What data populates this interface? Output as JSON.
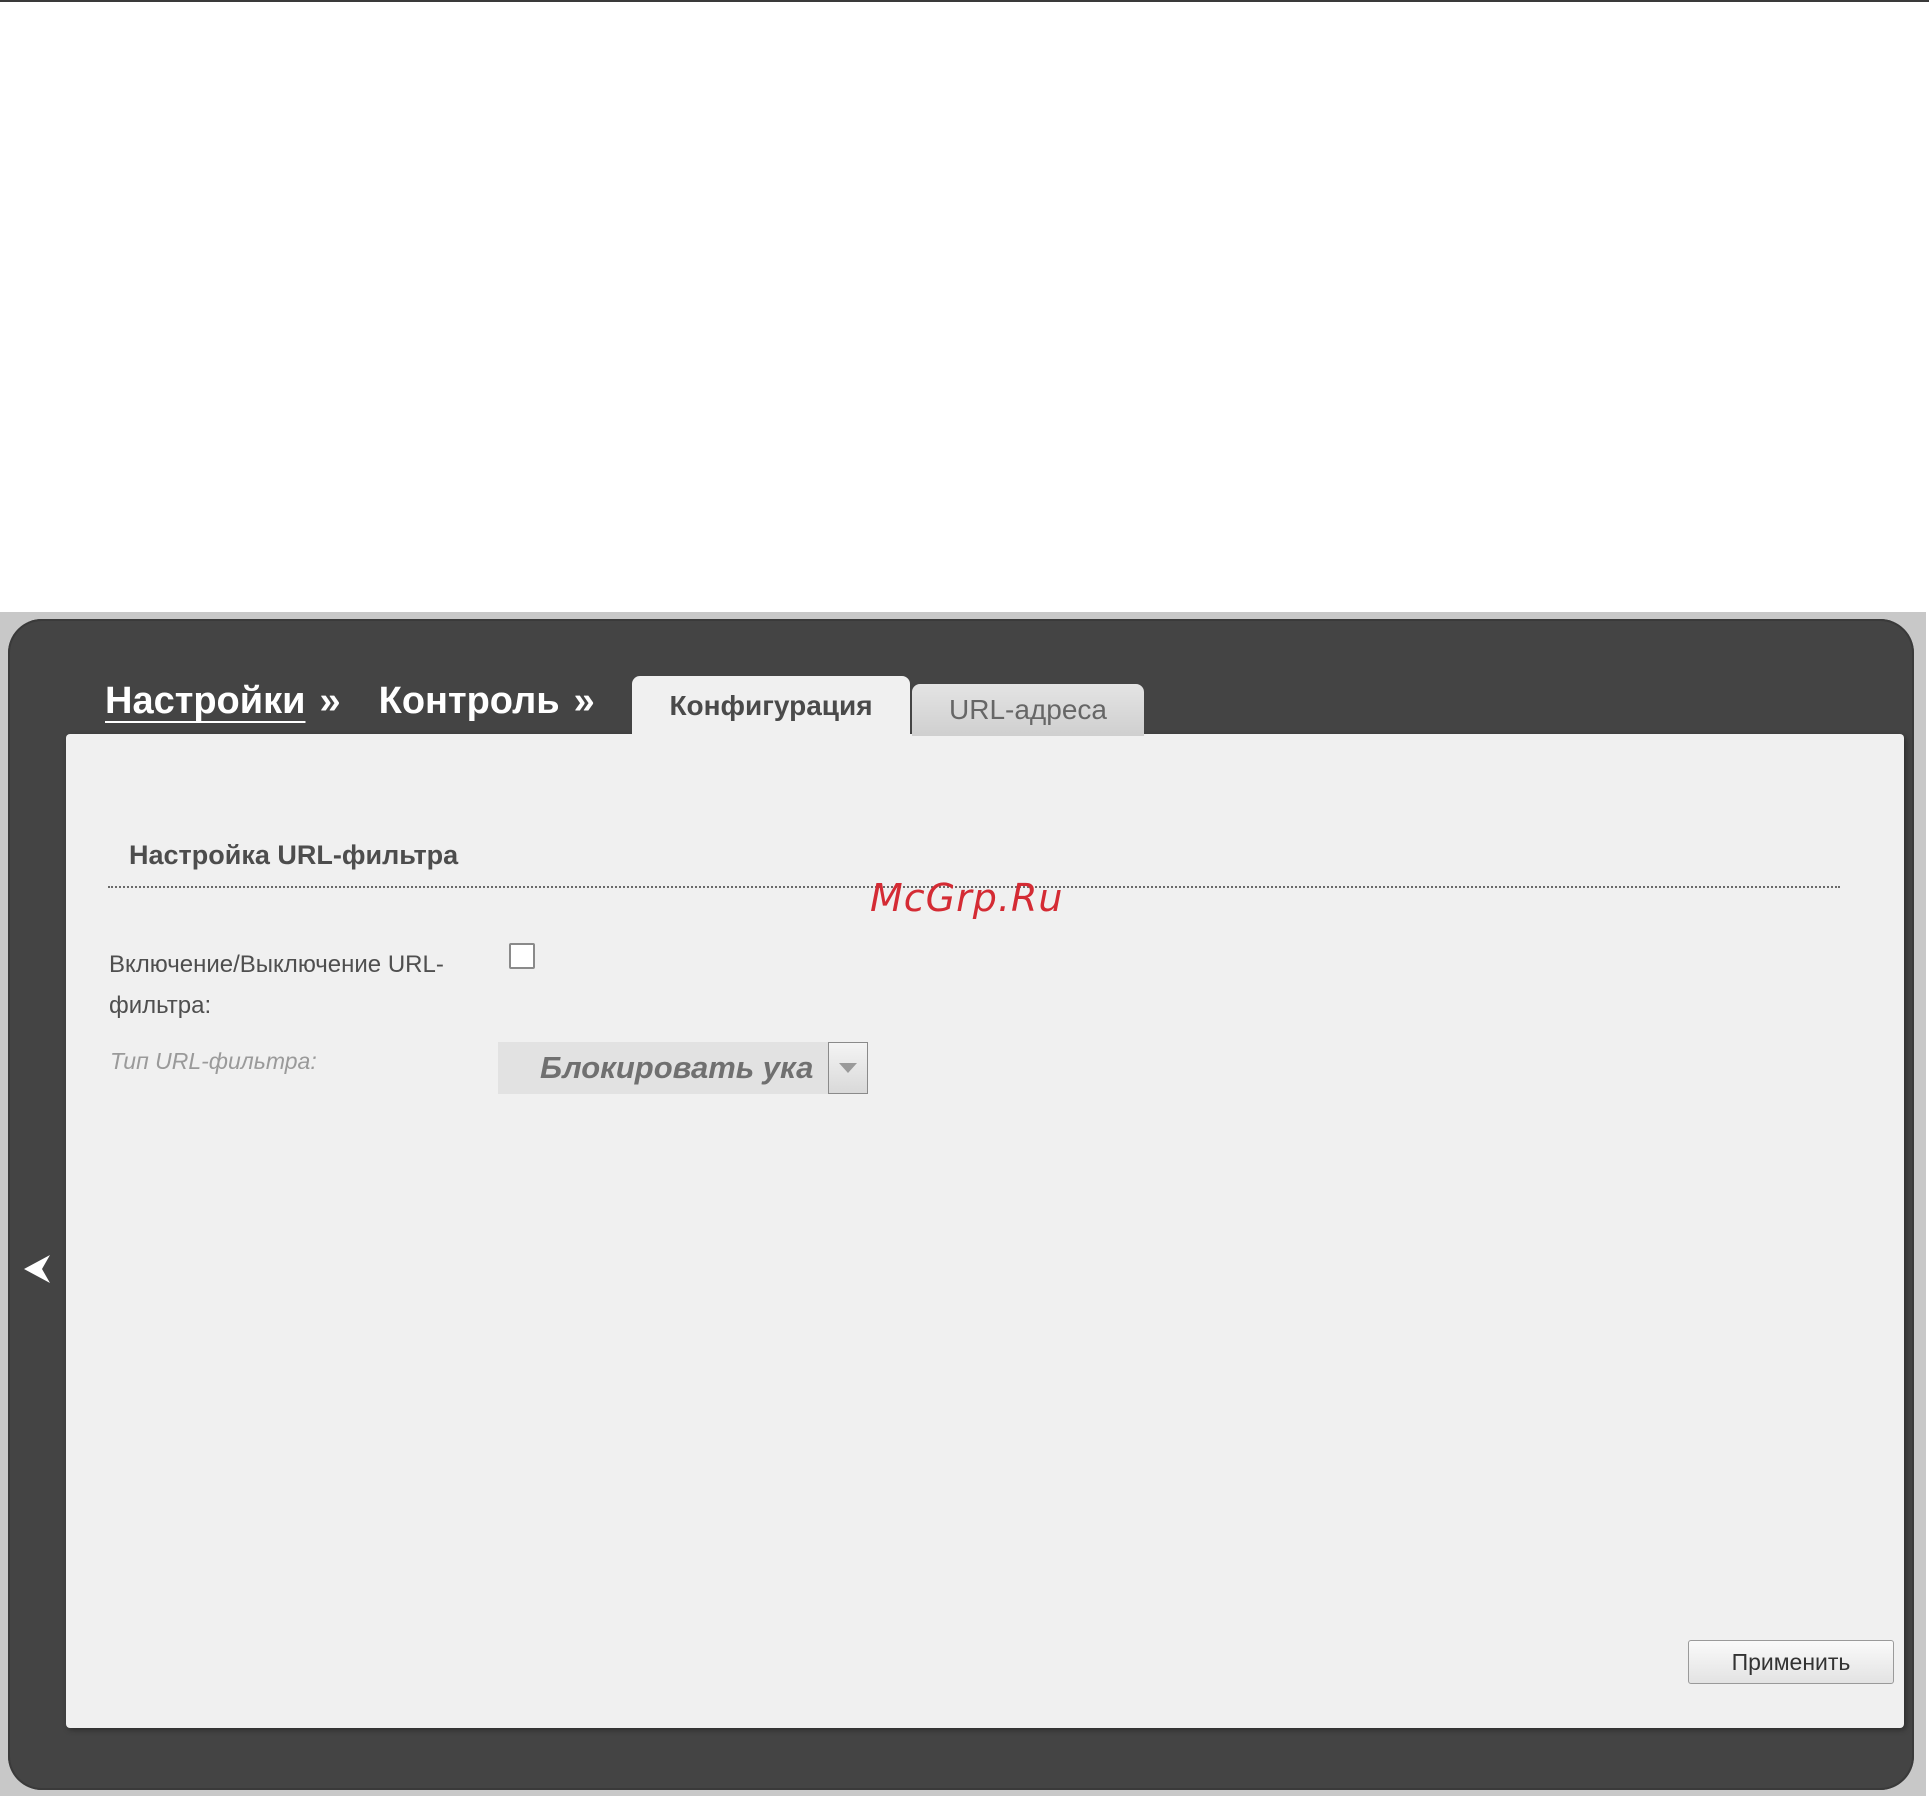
{
  "breadcrumb": {
    "items": [
      "Настройки",
      "Контроль"
    ],
    "separator": "»"
  },
  "tabs": [
    {
      "label": "Конфигурация",
      "active": true
    },
    {
      "label": "URL-адреса",
      "active": false
    }
  ],
  "section": {
    "title": "Настройка URL-фильтра"
  },
  "form": {
    "enable_label": "Включение/Выключение URL-фильтра:",
    "enable_checked": false,
    "type_label": "Тип URL-фильтра:",
    "type_value": "Блокировать ука"
  },
  "actions": {
    "apply_label": "Применить"
  },
  "watermark": "McGrp.Ru",
  "icons": {
    "side_toggle": "chevron-left-icon",
    "select_arrow": "chevron-down-icon"
  }
}
